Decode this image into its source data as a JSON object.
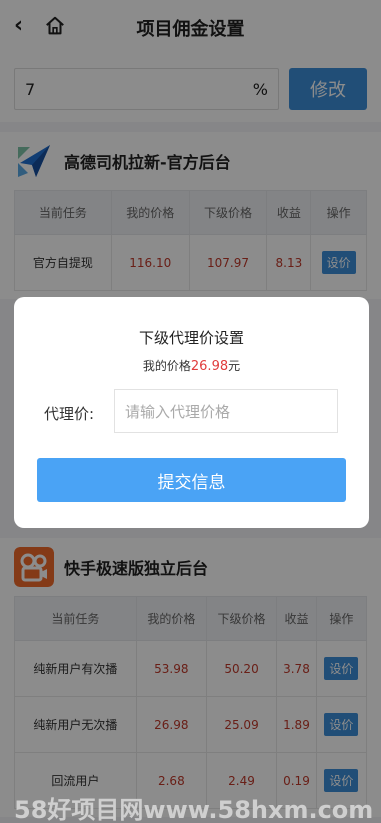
{
  "header": {
    "title": "项目佣金设置",
    "back_icon": "back-arrow-icon",
    "home_icon": "home-icon"
  },
  "rate": {
    "value": "7",
    "unit": "%",
    "modify_label": "修改"
  },
  "sections": [
    {
      "name": "高德司机拉新-官方后台",
      "logo_icon": "paper-plane-logo-icon",
      "columns": [
        "当前任务",
        "我的价格",
        "下级价格",
        "收益",
        "操作"
      ],
      "rows": [
        {
          "task": "官方自提现",
          "my_price": "116.10",
          "sub_price": "107.97",
          "profit": "8.13",
          "action": "设价"
        }
      ]
    },
    {
      "name": "快手极速版独立后台",
      "logo_icon": "kuaishou-logo-icon",
      "columns": [
        "当前任务",
        "我的价格",
        "下级价格",
        "收益",
        "操作"
      ],
      "rows": [
        {
          "task": "纯新用户有次播",
          "my_price": "53.98",
          "sub_price": "50.20",
          "profit": "3.78",
          "action": "设价"
        },
        {
          "task": "纯新用户无次播",
          "my_price": "26.98",
          "sub_price": "25.09",
          "profit": "1.89",
          "action": "设价"
        },
        {
          "task": "回流用户",
          "my_price": "2.68",
          "sub_price": "2.49",
          "profit": "0.19",
          "action": "设价"
        }
      ]
    }
  ],
  "modal": {
    "title": "下级代理价设置",
    "price_prefix": "我的价格",
    "price_value": "26.98",
    "price_suffix": "元",
    "agent_label": "代理价:",
    "agent_placeholder": "请输入代理价格",
    "submit_label": "提交信息"
  },
  "watermark": "58好项目网www.58hxm.com"
}
